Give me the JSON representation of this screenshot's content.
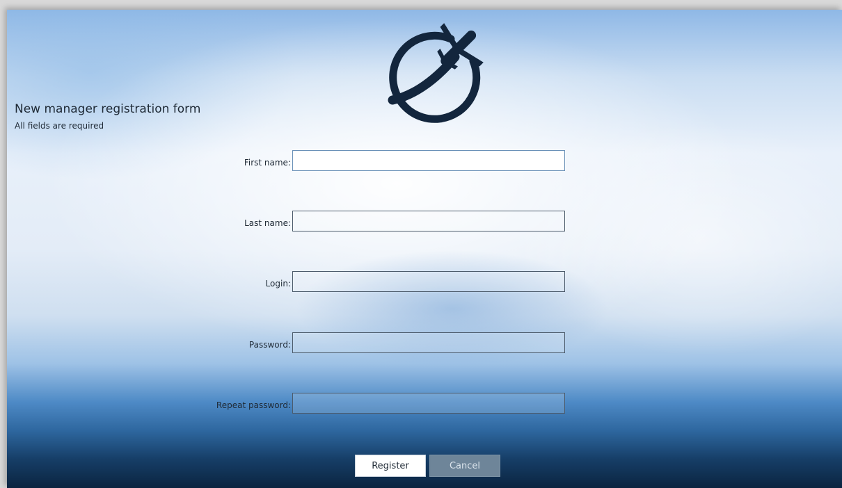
{
  "header": {
    "title": "New manager registration form",
    "subtitle": "All fields are required"
  },
  "logo": {
    "icon": "plane-globe-icon",
    "color": "#13263d"
  },
  "form": {
    "fields": [
      {
        "label": "First name:",
        "value": ""
      },
      {
        "label": "Last name:",
        "value": ""
      },
      {
        "label": "Login:",
        "value": ""
      },
      {
        "label": "Password:",
        "value": ""
      },
      {
        "label": "Repeat password:",
        "value": ""
      }
    ]
  },
  "buttons": {
    "register_label": "Register",
    "cancel_label": "Cancel"
  }
}
